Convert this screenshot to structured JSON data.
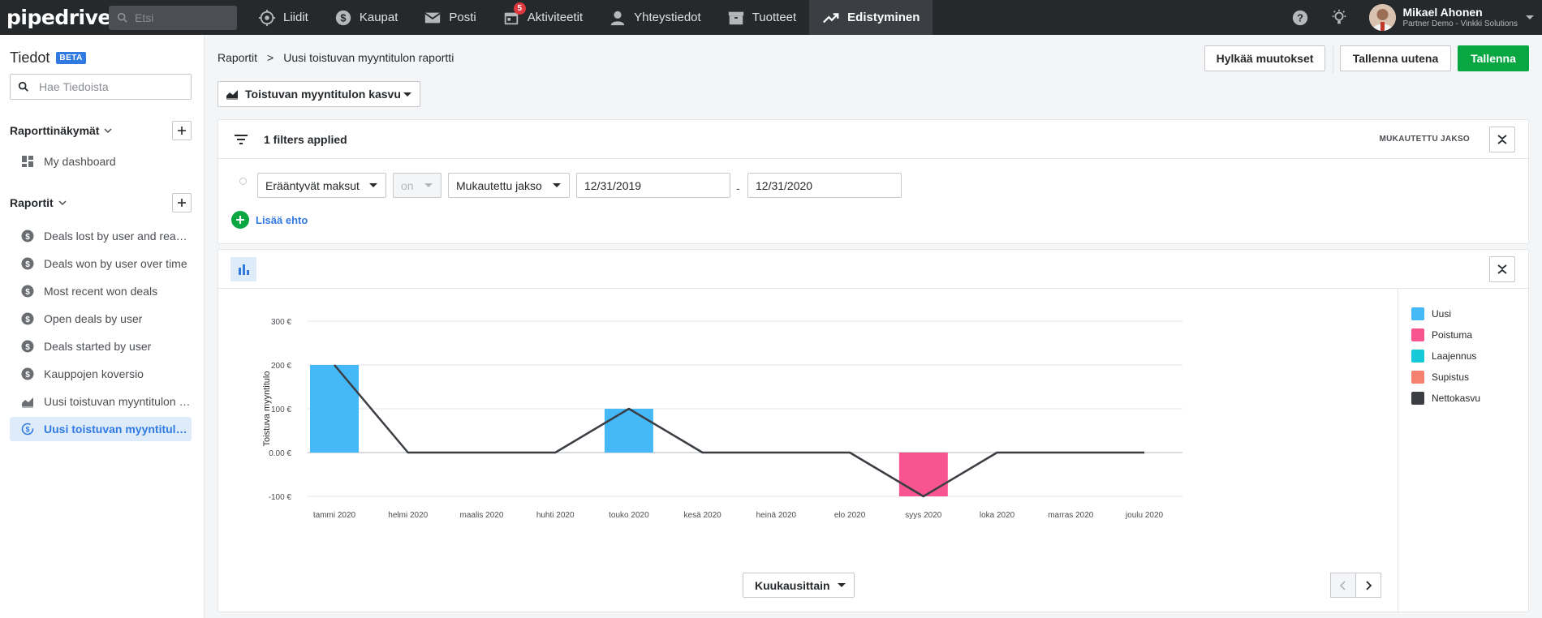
{
  "topbar": {
    "logo": "pipedrive",
    "search_placeholder": "Etsi",
    "nav": [
      {
        "label": "Liidit",
        "icon": "target-icon"
      },
      {
        "label": "Kaupat",
        "icon": "dollar-icon"
      },
      {
        "label": "Posti",
        "icon": "mail-icon"
      },
      {
        "label": "Aktiviteetit",
        "icon": "calendar-icon",
        "badge": "5"
      },
      {
        "label": "Yhteystiedot",
        "icon": "person-icon"
      },
      {
        "label": "Tuotteet",
        "icon": "box-icon"
      },
      {
        "label": "Edistyminen",
        "icon": "trend-icon",
        "active": true
      }
    ],
    "user": {
      "name": "Mikael Ahonen",
      "org": "Partner Demo - Vinkki Solutions"
    }
  },
  "sidebar": {
    "title": "Tiedot",
    "beta": "BETA",
    "search_placeholder": "Hae Tiedoista",
    "views_title": "Raporttinäkymät",
    "views": [
      {
        "label": "My dashboard"
      }
    ],
    "reports_title": "Raportit",
    "reports": [
      {
        "label": "Deals lost by user and reason",
        "icon": "dollar-icon"
      },
      {
        "label": "Deals won by user over time",
        "icon": "dollar-icon"
      },
      {
        "label": "Most recent won deals",
        "icon": "dollar-icon"
      },
      {
        "label": "Open deals by user",
        "icon": "dollar-icon"
      },
      {
        "label": "Deals started by user",
        "icon": "dollar-icon"
      },
      {
        "label": "Kauppojen koversio",
        "icon": "dollar-icon"
      },
      {
        "label": "Uusi toistuvan myyntitulon raportti",
        "icon": "area-chart-icon"
      },
      {
        "label": "Uusi toistuvan myyntitulon raportti",
        "icon": "recurring-icon",
        "active": true
      }
    ]
  },
  "header": {
    "breadcrumb_root": "Raportit",
    "breadcrumb_sep": ">",
    "breadcrumb_current": "Uusi toistuvan myyntitulon raportti",
    "discard_label": "Hylkää muutokset",
    "save_new_label": "Tallenna uutena",
    "save_label": "Tallenna",
    "report_type": "Toistuvan myyntitulon kasvu"
  },
  "filters": {
    "summary": "1 filters applied",
    "period_tag": "MUKAUTETTU JAKSO",
    "field": "Erääntyvät maksut",
    "operator": "on",
    "period": "Mukautettu jakso",
    "date_from": "12/31/2019",
    "date_sep": "-",
    "date_to": "12/31/2020",
    "add_condition": "Lisää ehto"
  },
  "chart_controls": {
    "grouping": "Kuukausittain"
  },
  "colors": {
    "uusi": "#45b8f8",
    "poistuma": "#f8548f",
    "laajennus": "#16c9d8",
    "supistus": "#f58270",
    "nettokasvu": "#3a3d41",
    "accent": "#317ae2",
    "green": "#08a742"
  },
  "chart_data": {
    "type": "bar",
    "ylabel": "Toistuva myyntitulo",
    "xlabel": "",
    "ylim": [
      -100,
      300
    ],
    "yticks": [
      {
        "value": 300,
        "label": "300 €"
      },
      {
        "value": 200,
        "label": "200 €"
      },
      {
        "value": 100,
        "label": "100 €"
      },
      {
        "value": 0,
        "label": "0.00 €"
      },
      {
        "value": -100,
        "label": "-100 €"
      }
    ],
    "categories": [
      "tammi 2020",
      "helmi 2020",
      "maalis 2020",
      "huhti 2020",
      "touko 2020",
      "kesä 2020",
      "heinä 2020",
      "elo 2020",
      "syys 2020",
      "loka 2020",
      "marras 2020",
      "joulu 2020"
    ],
    "series": [
      {
        "name": "Uusi",
        "kind": "bar",
        "color": "#45b8f8",
        "values": [
          200,
          0,
          0,
          0,
          100,
          0,
          0,
          0,
          0,
          0,
          0,
          0
        ]
      },
      {
        "name": "Poistuma",
        "kind": "bar",
        "color": "#f8548f",
        "values": [
          0,
          0,
          0,
          0,
          0,
          0,
          0,
          0,
          -100,
          0,
          0,
          0
        ]
      },
      {
        "name": "Laajennus",
        "kind": "bar",
        "color": "#16c9d8",
        "values": [
          0,
          0,
          0,
          0,
          0,
          0,
          0,
          0,
          0,
          0,
          0,
          0
        ]
      },
      {
        "name": "Supistus",
        "kind": "bar",
        "color": "#f58270",
        "values": [
          0,
          0,
          0,
          0,
          0,
          0,
          0,
          0,
          0,
          0,
          0,
          0
        ]
      },
      {
        "name": "Nettokasvu",
        "kind": "line",
        "color": "#3a3d41",
        "values": [
          200,
          0,
          0,
          0,
          100,
          0,
          0,
          0,
          -100,
          0,
          0,
          0
        ]
      }
    ],
    "legend_position": "right",
    "grid": true
  }
}
